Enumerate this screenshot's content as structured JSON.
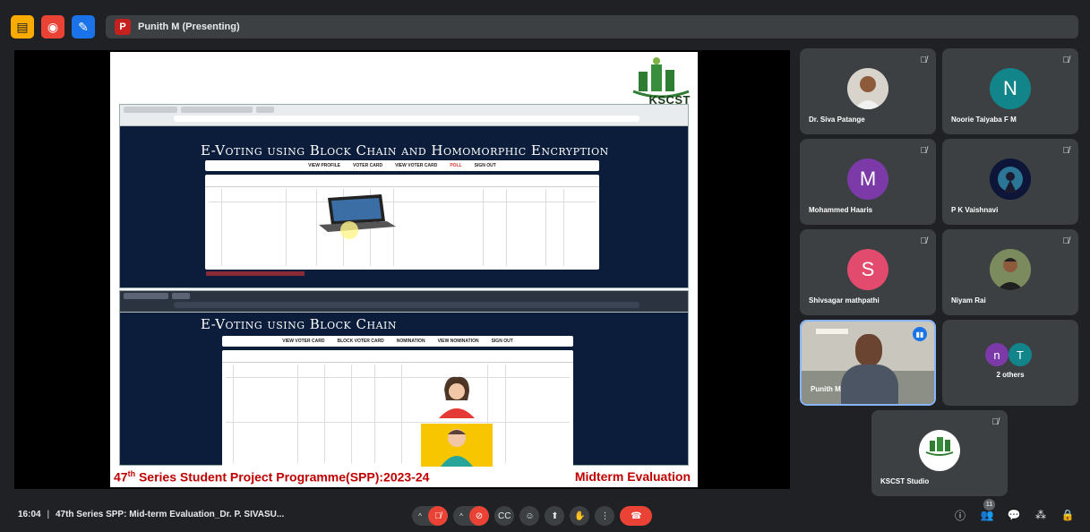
{
  "topbar": {
    "presenter_initial": "P",
    "presenting_label": "Punith M (Presenting)"
  },
  "slide": {
    "logo_text": "KSCST",
    "screenshot1_title": "E-Voting using Block Chain and Homomorphic Encryption",
    "screenshot1_nav": [
      "VIEW PROFILE",
      "VOTER CARD",
      "VIEW VOTER CARD",
      "POLL",
      "SIGN OUT"
    ],
    "screenshot2_title": "E-Voting using Block Chain",
    "screenshot2_nav": [
      "VIEW VOTER CARD",
      "BLOCK VOTER CARD",
      "NOMINATION",
      "VIEW NOMINATION",
      "SIGN OUT"
    ],
    "footer_left_prefix": "47",
    "footer_left_sup": "th",
    "footer_left_rest": " Series Student Project Programme(SPP):2023-24",
    "footer_right": "Midterm Evaluation"
  },
  "participants": [
    {
      "name": "Dr. Siva Patange",
      "initial": "",
      "muted": true
    },
    {
      "name": "Noorie Taiyaba F M",
      "initial": "N",
      "muted": true
    },
    {
      "name": "Mohammed Haaris",
      "initial": "M",
      "muted": true
    },
    {
      "name": "P K Vaishnavi",
      "initial": "",
      "muted": true
    },
    {
      "name": "Shivsagar mathpathi",
      "initial": "S",
      "muted": true
    },
    {
      "name": "Niyam Rai",
      "initial": "",
      "muted": true
    },
    {
      "name": "Punith M",
      "initial": "",
      "muted": false
    },
    {
      "name": "2 others",
      "initial": "",
      "muted": false,
      "minis": [
        "n",
        "T"
      ]
    },
    {
      "name": "KSCST Studio",
      "initial": "",
      "muted": true,
      "logo_text": "KSCST"
    }
  ],
  "bottombar": {
    "time": "16:04",
    "separator": "|",
    "meeting_title": "47th Series SPP: Mid-term Evaluation_Dr. P. SIVASU...",
    "participant_count": "11"
  },
  "colors": {
    "background": "#202124",
    "tile": "#3c4043",
    "danger": "#ea4335",
    "accent": "#1a73e8",
    "slide_footer": "#c00000"
  }
}
